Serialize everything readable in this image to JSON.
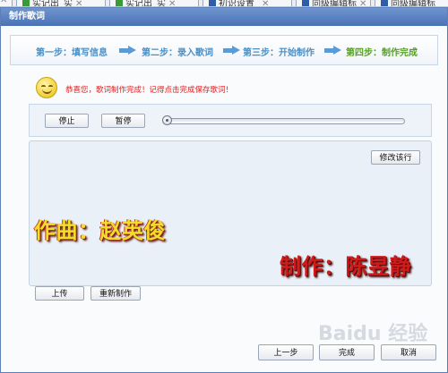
{
  "background_tabs": [
    {
      "label": "实记出_实",
      "icon_color": "#3a9a3a"
    },
    {
      "label": "实记出_实",
      "icon_color": "#3a9a3a"
    },
    {
      "label": "初识设置_",
      "icon_color": "#2e5ea8"
    },
    {
      "label": "同级编辑标",
      "icon_color": "#2e5ea8"
    },
    {
      "label": "同级编辑标",
      "icon_color": "#2e5ea8"
    }
  ],
  "dialog": {
    "title": "制作歌词"
  },
  "steps": [
    {
      "label": "第一步：填写信息",
      "active": false
    },
    {
      "label": "第二步：录入歌词",
      "active": false
    },
    {
      "label": "第三步：开始制作",
      "active": false
    },
    {
      "label": "第四步：制作完成",
      "active": true
    }
  ],
  "message": {
    "text": "恭喜您，歌词制作完成！记得点击完成保存歌词！",
    "icon": "smiley-icon"
  },
  "player": {
    "stop_label": "停止",
    "pause_label": "暂停",
    "progress": 0.0
  },
  "lyrics_panel": {
    "edit_line_label": "修改该行",
    "composer_text": "作曲：赵英俊",
    "producer_text": "制作：陈昱静"
  },
  "actions": {
    "upload_label": "上传",
    "remake_label": "重新制作"
  },
  "footer": {
    "prev_label": "上一步",
    "finish_label": "完成",
    "cancel_label": "取消"
  },
  "watermark": "Baidu 经验",
  "colors": {
    "step_inactive": "#4a8fc4",
    "step_active": "#57a024",
    "arrow": "#5b9bd5",
    "message": "#e02020",
    "composer": "#f2dd2a",
    "producer": "#d01b1b"
  }
}
